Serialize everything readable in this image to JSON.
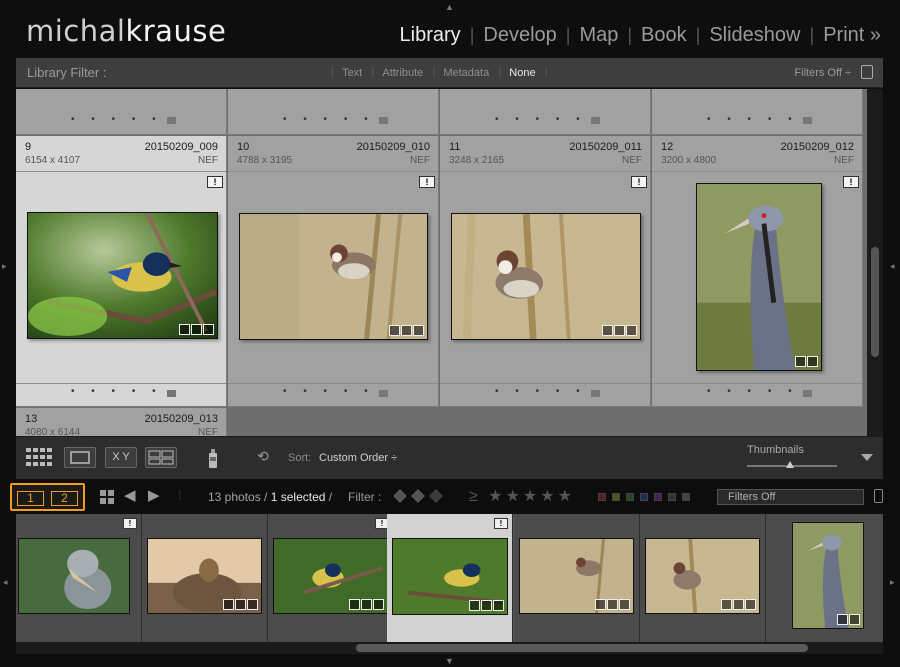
{
  "identity": {
    "name_light": "michal",
    "name_bold": "krause"
  },
  "modules": [
    {
      "label": "Library",
      "active": true
    },
    {
      "label": "Develop",
      "active": false
    },
    {
      "label": "Map",
      "active": false
    },
    {
      "label": "Book",
      "active": false
    },
    {
      "label": "Slideshow",
      "active": false
    },
    {
      "label": "Print »",
      "active": false
    }
  ],
  "library_filter": {
    "title": "Library Filter :",
    "options": [
      "Text",
      "Attribute",
      "Metadata",
      "None"
    ],
    "selected": "None",
    "preset": "Filters Off ÷"
  },
  "grid": {
    "cells": [
      {
        "num": "9",
        "file": "20150209_009",
        "dims": "6154 x 4107",
        "ext": "NEF",
        "selected": true
      },
      {
        "num": "10",
        "file": "20150209_010",
        "dims": "4788 x 3195",
        "ext": "NEF",
        "selected": false
      },
      {
        "num": "11",
        "file": "20150209_011",
        "dims": "3248 x 2165",
        "ext": "NEF",
        "selected": false
      },
      {
        "num": "12",
        "file": "20150209_012",
        "dims": "3200 x 4800",
        "ext": "NEF",
        "selected": false
      },
      {
        "num": "13",
        "file": "20150209_013",
        "dims": "4080 x 6144",
        "ext": "NEF",
        "selected": false
      }
    ],
    "badge": "!",
    "footer_dots": "• • • • •"
  },
  "toolbar": {
    "xy_label": "X Y",
    "sort_label": "Sort:",
    "sort_value": "Custom Order ÷",
    "thumbnails_label": "Thumbnails",
    "thumbnail_size": 0.45
  },
  "filmstrip_header": {
    "screen1": "1",
    "screen2": "2",
    "count_prefix": "13 photos /",
    "count_selected": "1 selected",
    "count_suffix": "/",
    "filter_label": "Filter :",
    "stars": "≥ ★★★★★",
    "label_colors": [
      "#d33",
      "#cc3",
      "#3a3",
      "#36c",
      "#a3c",
      "#777",
      "#ccc"
    ],
    "preset": "Filters Off"
  },
  "filmstrip": {
    "badge": "!",
    "selected_index": 3
  }
}
